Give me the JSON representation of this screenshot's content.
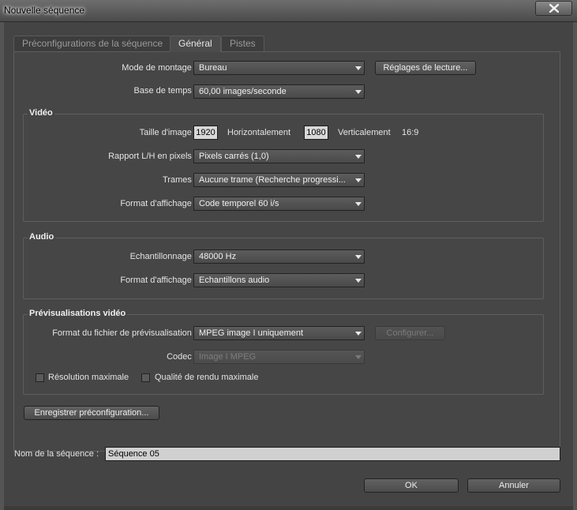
{
  "window": {
    "title": "Nouvelle séquence"
  },
  "tabs": [
    {
      "label": "Préconfigurations de la séquence",
      "active": false
    },
    {
      "label": "Général",
      "active": true
    },
    {
      "label": "Pistes",
      "active": false
    }
  ],
  "general": {
    "editing_mode": {
      "label": "Mode de montage :",
      "value": "Bureau"
    },
    "playback_settings_button": "Réglages de lecture...",
    "timebase": {
      "label": "Base de temps :",
      "value": "60,00 images/seconde"
    }
  },
  "video": {
    "title": "Vidéo",
    "frame_size": {
      "label": "Taille d'image :",
      "width": "1920",
      "horizontal_label": "Horizontalement",
      "height": "1080",
      "vertical_label": "Verticalement",
      "ratio": "16:9"
    },
    "pixel_aspect": {
      "label": "Rapport L/H en pixels :",
      "value": "Pixels carrés (1,0)"
    },
    "fields": {
      "label": "Trames :",
      "value": "Aucune trame (Recherche progressi..."
    },
    "display_format": {
      "label": "Format d'affichage :",
      "value": "Code temporel 60 i/s"
    }
  },
  "audio": {
    "title": "Audio",
    "sample_rate": {
      "label": "Echantillonnage :",
      "value": "48000 Hz"
    },
    "display_format": {
      "label": "Format d'affichage :",
      "value": "Echantillons audio"
    }
  },
  "previews": {
    "title": "Prévisualisations vidéo",
    "file_format": {
      "label": "Format du fichier de prévisualisation :",
      "value": "MPEG image I uniquement"
    },
    "configure_button": "Configurer...",
    "codec": {
      "label": "Codec :",
      "value": "Image I MPEG"
    },
    "max_resolution": {
      "label": "Résolution maximale",
      "checked": false
    },
    "max_quality": {
      "label": "Qualité de rendu maximale",
      "checked": false
    }
  },
  "save_preset_button": "Enregistrer préconfiguration...",
  "sequence_name": {
    "label": "Nom de la séquence :",
    "value": "Séquence 05"
  },
  "ok_button": "OK",
  "cancel_button": "Annuler"
}
